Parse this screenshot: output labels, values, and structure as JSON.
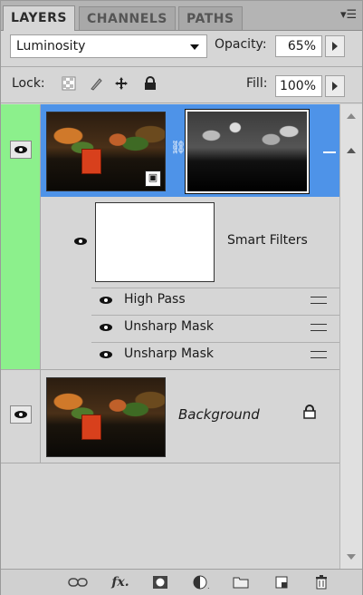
{
  "tabs": [
    {
      "label": "LAYERS",
      "active": true
    },
    {
      "label": "CHANNELS",
      "active": false
    },
    {
      "label": "PATHS",
      "active": false
    }
  ],
  "blend_mode": "Luminosity",
  "opacity": {
    "label": "Opacity:",
    "value": "65%"
  },
  "lock": {
    "label": "Lock:",
    "icons": [
      "lock-transparent-pixels-icon",
      "lock-image-pixels-icon",
      "lock-position-icon",
      "lock-all-icon"
    ]
  },
  "fill": {
    "label": "Fill:",
    "value": "100%"
  },
  "layers": [
    {
      "name": "",
      "type": "smart-object",
      "selected": true,
      "visible": true
    },
    {
      "name": "Background",
      "type": "background",
      "selected": false,
      "visible": true,
      "locked": true
    }
  ],
  "smart_filters": {
    "label": "Smart Filters",
    "items": [
      {
        "name": "High Pass"
      },
      {
        "name": "Unsharp Mask"
      },
      {
        "name": "Unsharp Mask"
      }
    ]
  },
  "bottom_icons": [
    "link-layers-icon",
    "layer-style-fx-icon",
    "add-mask-icon",
    "adjustment-layer-icon",
    "new-group-icon",
    "new-layer-icon",
    "delete-layer-icon"
  ],
  "colors": {
    "selection": "#4e93e8",
    "visibility_highlight": "#8cf08c"
  }
}
